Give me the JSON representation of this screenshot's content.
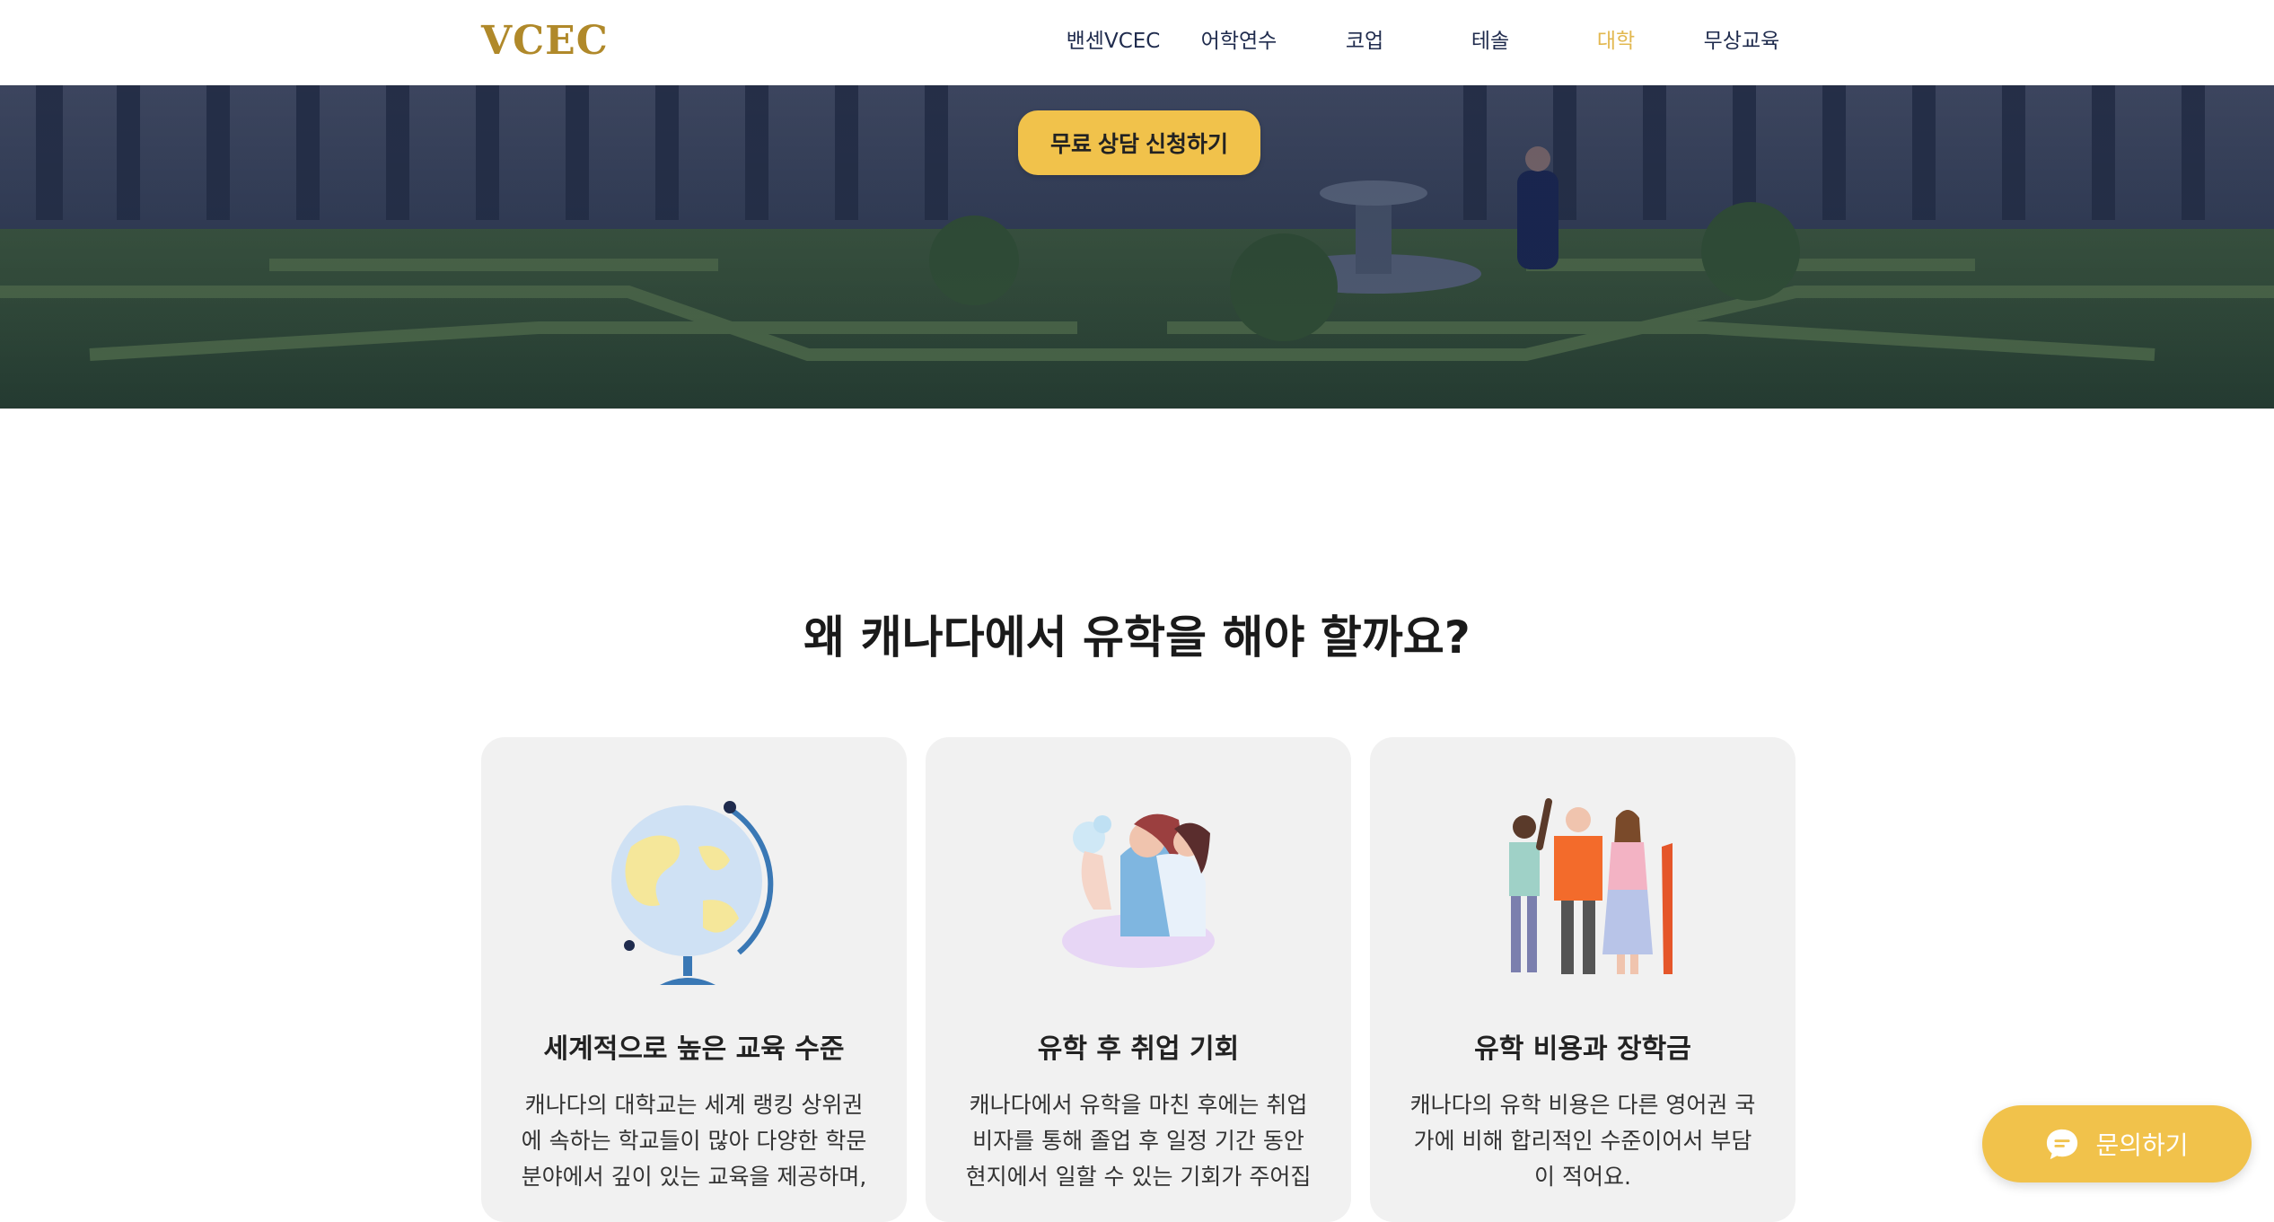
{
  "header": {
    "logo": "VCEC",
    "nav": [
      "밴센VCEC",
      "어학연수",
      "코업",
      "테솔",
      "대학",
      "무상교육"
    ],
    "active_index": 4
  },
  "hero": {
    "cta_label": "무료 상담 신청하기"
  },
  "section": {
    "title": "왜 캐나다에서 유학을 해야 할까요?"
  },
  "cards": [
    {
      "title": "세계적으로 높은 교육 수준",
      "body": "캐나다의 대학교는 세계 랭킹 상위권에 속하는 학교들이 많아 다양한 학문 분야에서 깊이 있는 교육을 제공하며,",
      "icon": "globe-icon"
    },
    {
      "title": "유학 후 취업 기회",
      "body": "캐나다에서 유학을 마친 후에는 취업 비자를 통해 졸업 후 일정 기간 동안 현지에서 일할 수 있는 기회가 주어집",
      "icon": "career-icon"
    },
    {
      "title": "유학 비용과 장학금",
      "body": "캐나다의 유학 비용은 다른 영어권 국가에 비해 합리적인 수준이어서 부담이 적어요.",
      "icon": "people-icon"
    }
  ],
  "chat": {
    "label": "문의하기"
  },
  "colors": {
    "accent": "#f1c24b",
    "nav_active": "#e2b850",
    "logo": "#b0892a",
    "nav_text": "#1f2b4d"
  }
}
